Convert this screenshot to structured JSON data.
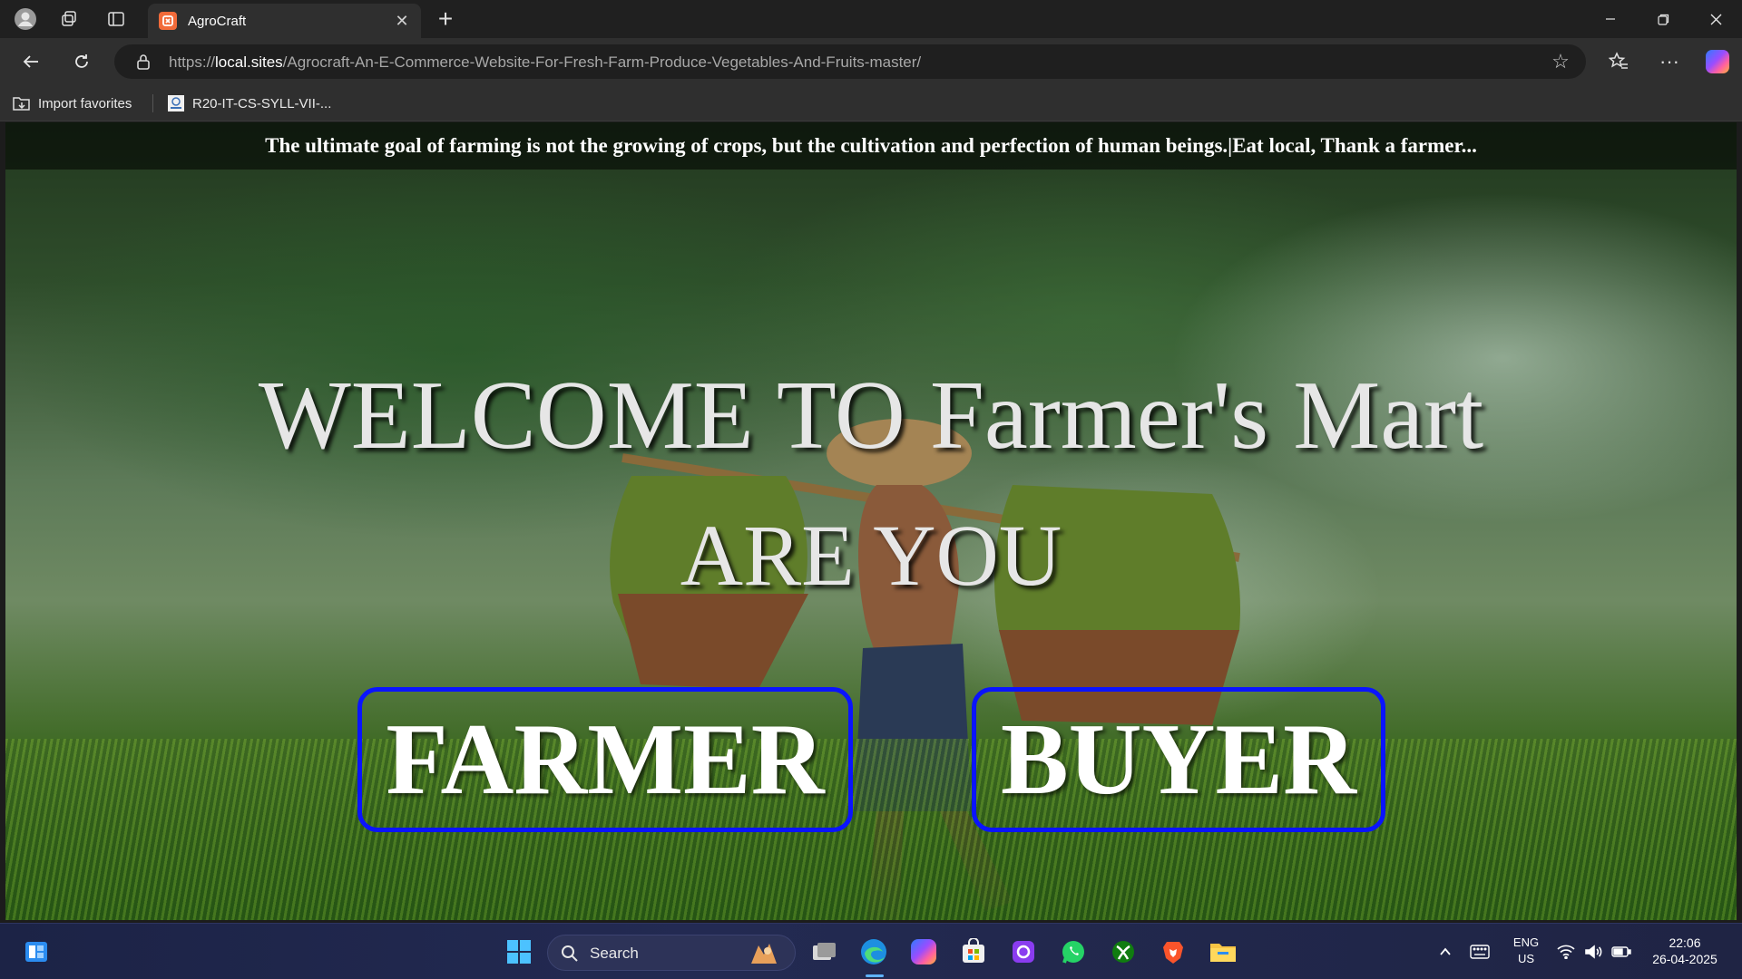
{
  "browser": {
    "tab": {
      "title": "AgroCraft",
      "favicon_letter": "᪛"
    },
    "address": {
      "prefix": "https://",
      "host": "local.sites",
      "path": "/Agrocraft-An-E-Commerce-Website-For-Fresh-Farm-Produce-Vegetables-And-Fruits-master/"
    },
    "favorites": [
      {
        "label": "Import favorites"
      },
      {
        "label": "R20-IT-CS-SYLL-VII-..."
      }
    ]
  },
  "page": {
    "quote": "The ultimate goal of farming is not the growing of crops, but the cultivation and perfection of human beings.|Eat local, Thank a farmer...",
    "welcome": "WELCOME TO Farmer's Mart",
    "question": "ARE YOU",
    "buttons": {
      "farmer": "FARMER",
      "buyer": "BUYER"
    },
    "button_border_color": "#0a14ff"
  },
  "taskbar": {
    "search_label": "Search",
    "language": "ENG",
    "region": "US",
    "time": "22:06",
    "date": "26-04-2025"
  }
}
